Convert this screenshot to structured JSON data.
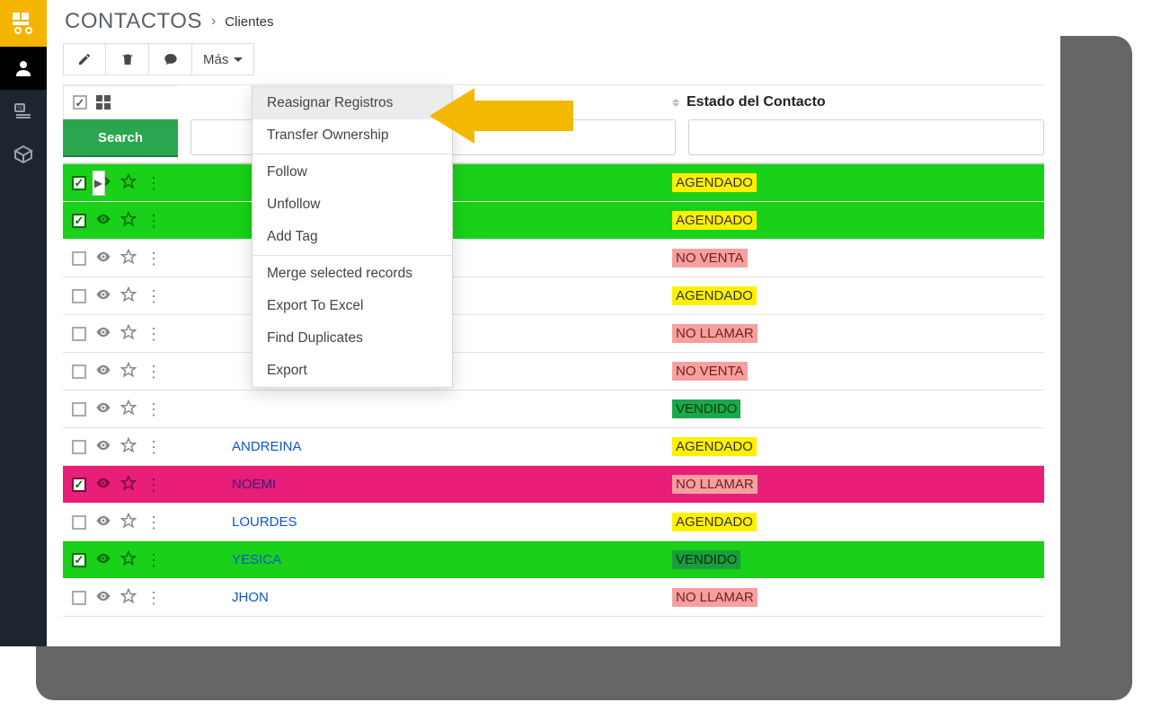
{
  "breadcrumb": {
    "module": "CONTACTOS",
    "view": "Clientes"
  },
  "toolbar": {
    "mas_label": "Más"
  },
  "columns": {
    "status_header": "Estado del Contacto"
  },
  "search": {
    "button_label": "Search"
  },
  "dropdown": {
    "group1": [
      "Reasignar Registros",
      "Transfer Ownership"
    ],
    "group2": [
      "Follow",
      "Unfollow",
      "Add Tag"
    ],
    "group3": [
      "Merge selected records",
      "Export To Excel",
      "Find Duplicates",
      "Export"
    ],
    "hover_index": 0
  },
  "status_styles": {
    "AGENDADO": {
      "bg": "#fff000",
      "fg": "#333"
    },
    "NO VENTA": {
      "bg": "#f5a0a0",
      "fg": "#7a1a1a"
    },
    "NO LLAMAR": {
      "bg": "#f5a0a0",
      "fg": "#7a1a1a"
    },
    "VENDIDO": {
      "bg": "#1aa84a",
      "fg": "#0c3d0c"
    }
  },
  "rows": [
    {
      "name": "",
      "status": "AGENDADO",
      "highlight": "green",
      "checked": true
    },
    {
      "name": "",
      "status": "AGENDADO",
      "highlight": "green",
      "checked": true
    },
    {
      "name": "",
      "status": "NO VENTA",
      "highlight": "",
      "checked": false
    },
    {
      "name": "",
      "status": "AGENDADO",
      "highlight": "",
      "checked": false
    },
    {
      "name": "",
      "status": "NO LLAMAR",
      "highlight": "",
      "checked": false
    },
    {
      "name": "",
      "status": "NO VENTA",
      "highlight": "",
      "checked": false
    },
    {
      "name": "",
      "status": "VENDIDO",
      "highlight": "",
      "checked": false
    },
    {
      "name": "ANDREINA",
      "status": "AGENDADO",
      "highlight": "",
      "checked": false
    },
    {
      "name": "NOEMI",
      "status": "NO LLAMAR",
      "highlight": "pink",
      "checked": true
    },
    {
      "name": "LOURDES",
      "status": "AGENDADO",
      "highlight": "",
      "checked": false
    },
    {
      "name": "YESICA",
      "status": "VENDIDO",
      "highlight": "green",
      "checked": true
    },
    {
      "name": "JHON",
      "status": "NO LLAMAR",
      "highlight": "",
      "checked": false
    }
  ]
}
